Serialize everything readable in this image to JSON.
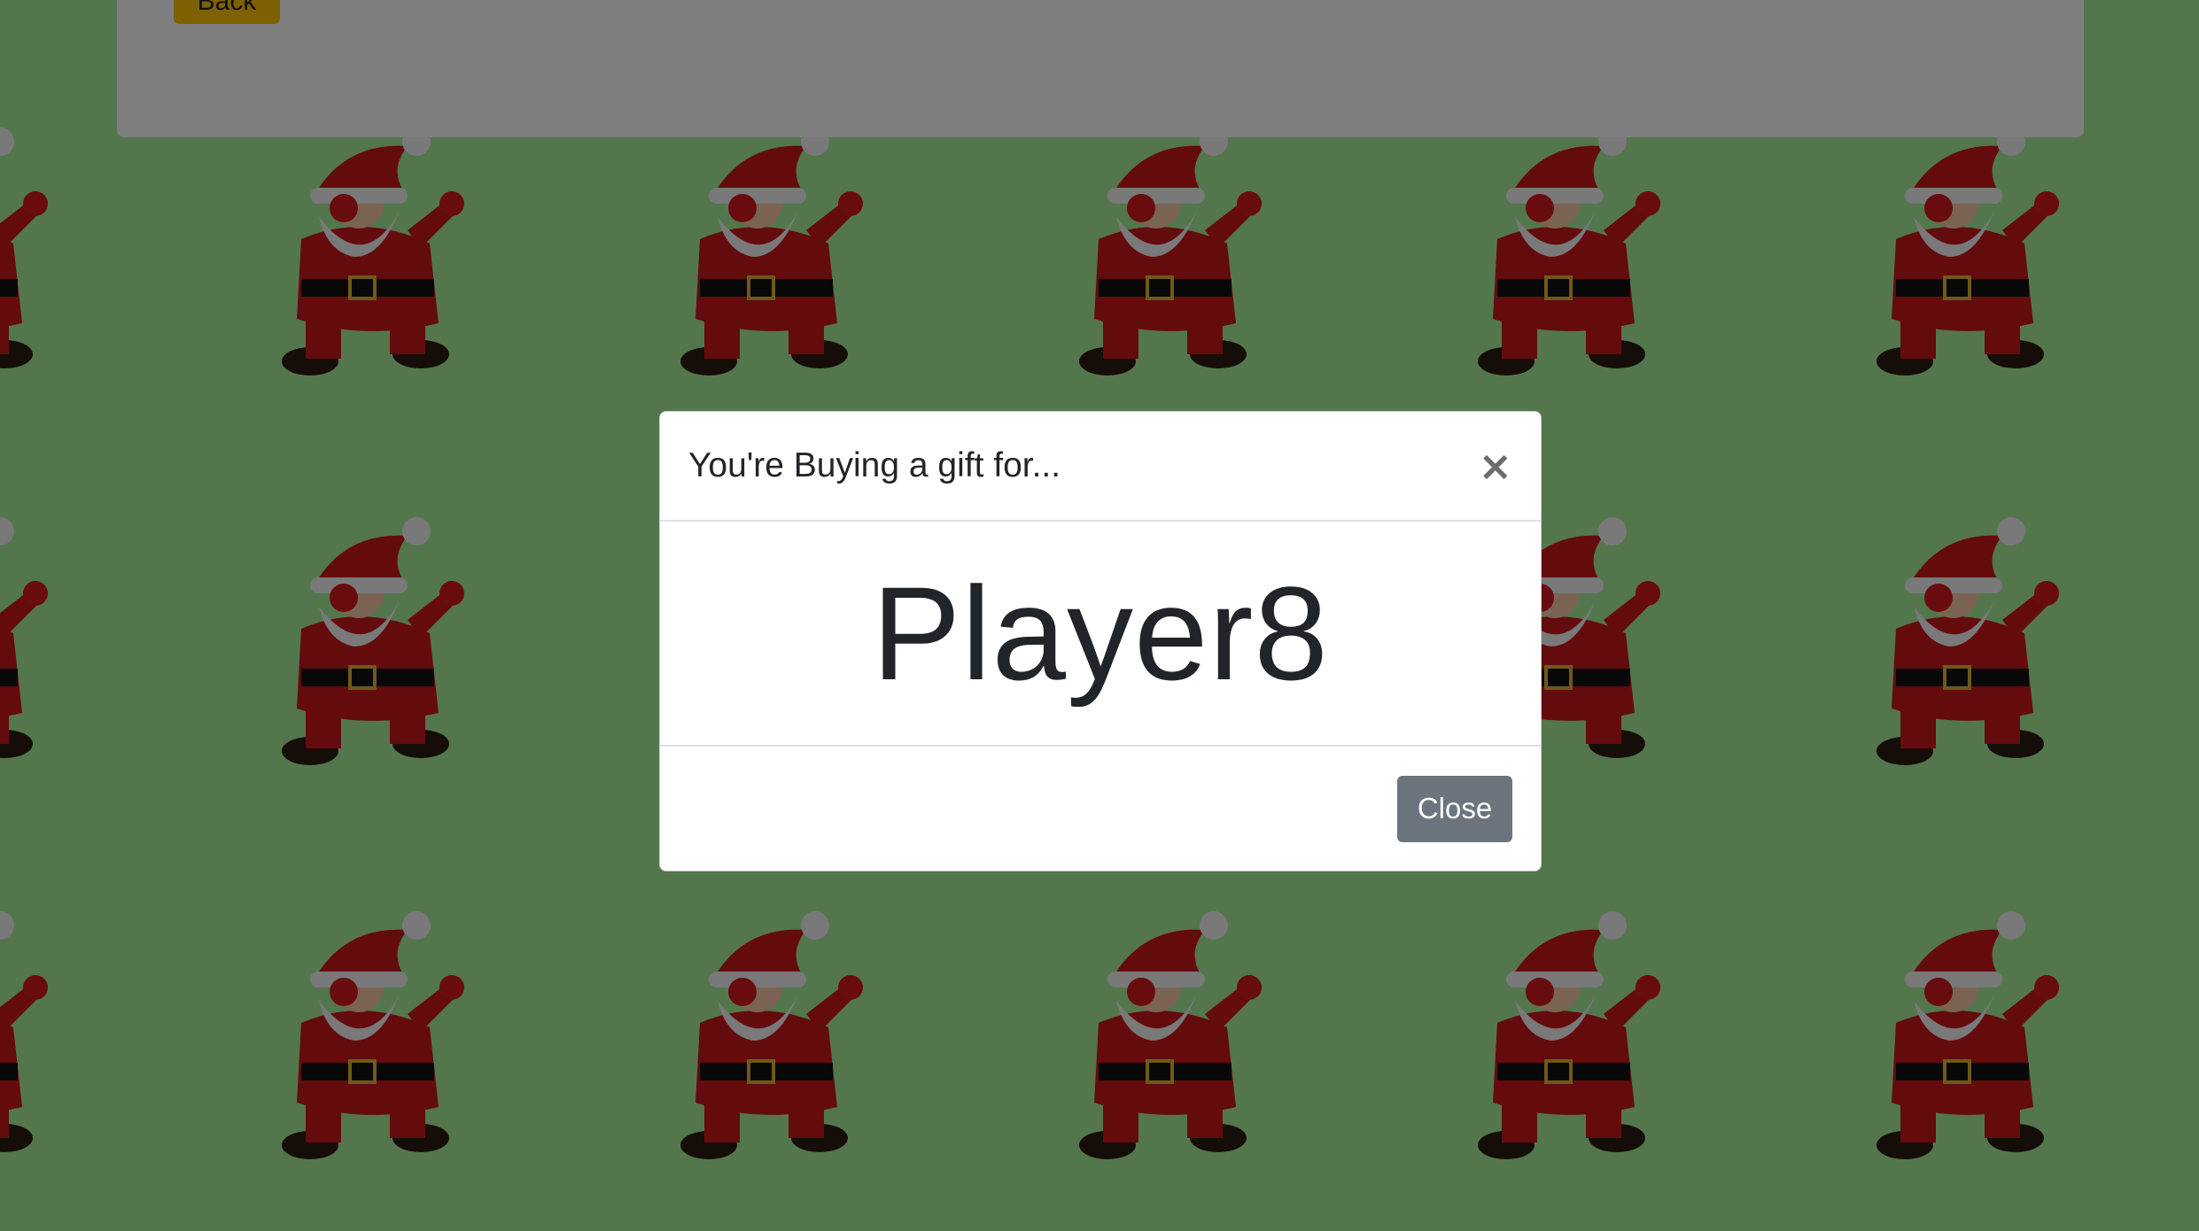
{
  "colors": {
    "background": "#a9ec9a",
    "overlay": "rgba(0,0,0,0.5)",
    "modal_bg": "#ffffff",
    "close_button_bg": "#6c757d",
    "back_button_bg": "#ffc107"
  },
  "top_card": {
    "back_label": "Back"
  },
  "background_pattern": {
    "icon": "dabbing-santa-icon"
  },
  "modal": {
    "title": "You're Buying a gift for...",
    "close_icon": "×",
    "player": "Player8",
    "close_label": "Close"
  }
}
